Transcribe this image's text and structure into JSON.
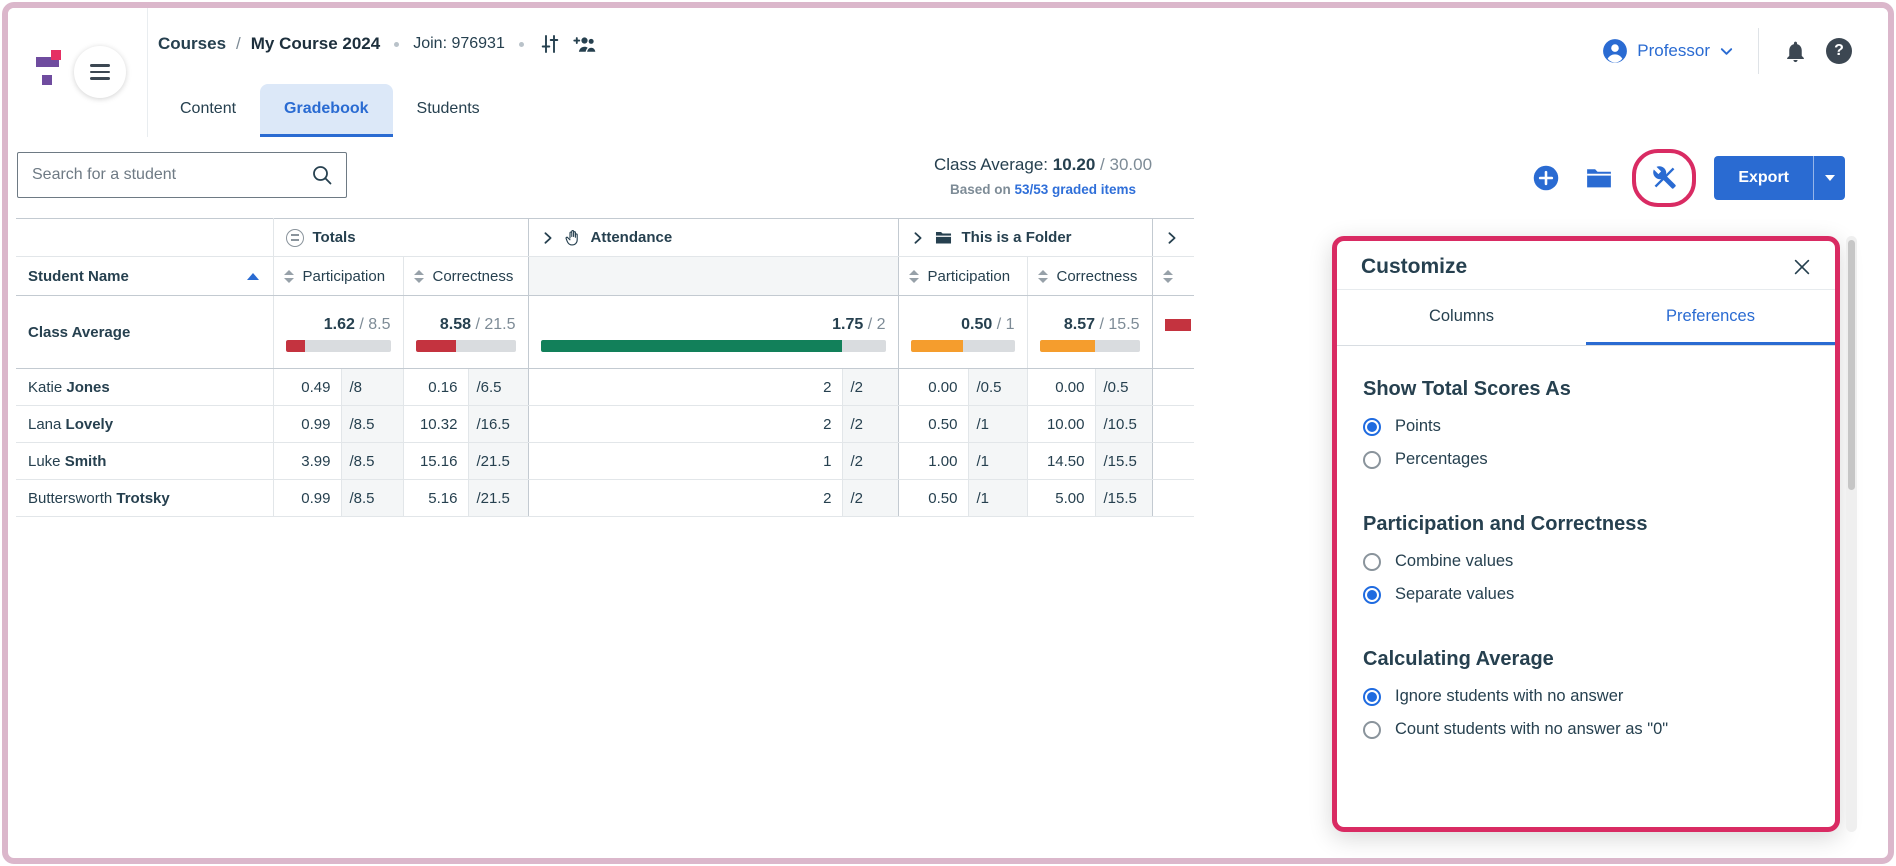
{
  "colors": {
    "accent_blue": "#2a6bd2",
    "link_blue": "#2f6fd9",
    "navy": "#26404f",
    "muted": "#7d8b96",
    "bar_red": "#c4333f",
    "bar_green": "#12805a",
    "bar_orange": "#f59d2d",
    "bar_track": "#d9dcdf",
    "annotation_pink": "#d92b63",
    "frame_pink": "#dbb7cb",
    "logo_purple": "#6f4c9f",
    "logo_pink": "#e52f63"
  },
  "header": {
    "breadcrumb": {
      "root": "Courses",
      "separator": "/",
      "current": "My Course 2024"
    },
    "join_label": "Join: 976931",
    "tabs": [
      {
        "label": "Content"
      },
      {
        "label": "Gradebook"
      },
      {
        "label": "Students"
      }
    ],
    "account_name": "Professor",
    "help_glyph": "?"
  },
  "toolbar": {
    "search_placeholder": "Search for a student",
    "class_average": {
      "label": "Class Average:",
      "value": "10.20",
      "sep": "/",
      "max": "30.00",
      "based_prefix": "Based on",
      "based_link": "53/53 graded items"
    },
    "export_label": "Export"
  },
  "table": {
    "groups": [
      {
        "label": "Totals"
      },
      {
        "label": "Attendance"
      },
      {
        "label": "This is a Folder"
      }
    ],
    "head": {
      "name_label": "Student Name",
      "participation": "Participation",
      "correctness": "Correctness"
    },
    "avg": {
      "label": "Class Average",
      "sep": "/",
      "cells": [
        {
          "v": "1.62",
          "m": "8.5",
          "pct": 19,
          "color": "#c4333f"
        },
        {
          "v": "8.58",
          "m": "21.5",
          "pct": 40,
          "color": "#c4333f"
        },
        {
          "v": "1.75",
          "m": "2",
          "pct": 87.5,
          "color": "#12805a"
        },
        {
          "v": "0.50",
          "m": "1",
          "pct": 50,
          "color": "#f59d2d"
        },
        {
          "v": "8.57",
          "m": "15.5",
          "pct": 55,
          "color": "#f59d2d"
        }
      ],
      "trailing": {
        "color": "#c4333f"
      }
    },
    "rows": [
      {
        "first": "Katie",
        "last": "Jones",
        "c": [
          "0.49",
          "/8",
          "0.16",
          "/6.5",
          "2",
          "/2",
          "0.00",
          "/0.5",
          "0.00",
          "/0.5"
        ]
      },
      {
        "first": "Lana",
        "last": "Lovely",
        "c": [
          "0.99",
          "/8.5",
          "10.32",
          "/16.5",
          "2",
          "/2",
          "0.50",
          "/1",
          "10.00",
          "/10.5"
        ]
      },
      {
        "first": "Luke",
        "last": "Smith",
        "c": [
          "3.99",
          "/8.5",
          "15.16",
          "/21.5",
          "1",
          "/2",
          "1.00",
          "/1",
          "14.50",
          "/15.5"
        ]
      },
      {
        "first": "Buttersworth",
        "last": "Trotsky",
        "c": [
          "0.99",
          "/8.5",
          "5.16",
          "/21.5",
          "2",
          "/2",
          "0.50",
          "/1",
          "5.00",
          "/15.5"
        ]
      }
    ]
  },
  "panel": {
    "title": "Customize",
    "tabs": [
      {
        "label": "Columns"
      },
      {
        "label": "Preferences"
      }
    ],
    "sections": [
      {
        "heading": "Show Total Scores As",
        "options": [
          {
            "label": "Points",
            "selected": true
          },
          {
            "label": "Percentages",
            "selected": false
          }
        ]
      },
      {
        "heading": "Participation and Correctness",
        "options": [
          {
            "label": "Combine values",
            "selected": false
          },
          {
            "label": "Separate values",
            "selected": true
          }
        ]
      },
      {
        "heading": "Calculating Average",
        "options": [
          {
            "label": "Ignore students with no answer",
            "selected": true
          },
          {
            "label": "Count students with no answer as \"0\"",
            "selected": false
          }
        ]
      }
    ]
  }
}
